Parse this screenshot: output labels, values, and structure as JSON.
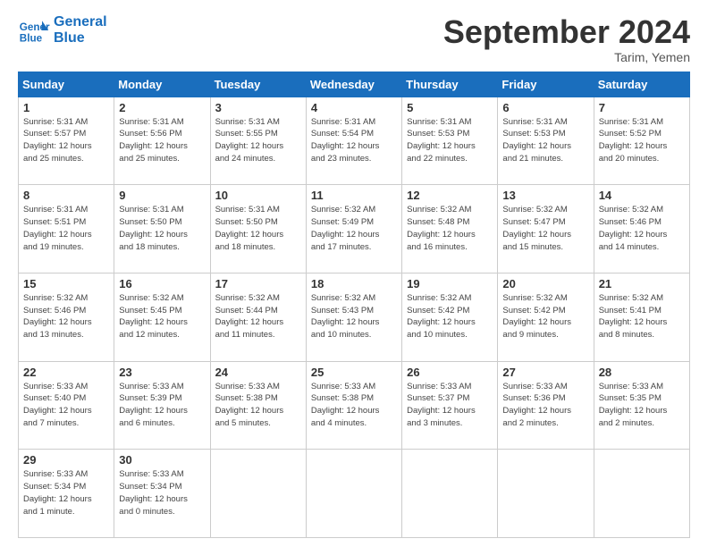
{
  "header": {
    "logo_line1": "General",
    "logo_line2": "Blue",
    "month_title": "September 2024",
    "location": "Tarim, Yemen"
  },
  "weekdays": [
    "Sunday",
    "Monday",
    "Tuesday",
    "Wednesday",
    "Thursday",
    "Friday",
    "Saturday"
  ],
  "weeks": [
    [
      {
        "day": 1,
        "info": "Sunrise: 5:31 AM\nSunset: 5:57 PM\nDaylight: 12 hours\nand 25 minutes."
      },
      {
        "day": 2,
        "info": "Sunrise: 5:31 AM\nSunset: 5:56 PM\nDaylight: 12 hours\nand 25 minutes."
      },
      {
        "day": 3,
        "info": "Sunrise: 5:31 AM\nSunset: 5:55 PM\nDaylight: 12 hours\nand 24 minutes."
      },
      {
        "day": 4,
        "info": "Sunrise: 5:31 AM\nSunset: 5:54 PM\nDaylight: 12 hours\nand 23 minutes."
      },
      {
        "day": 5,
        "info": "Sunrise: 5:31 AM\nSunset: 5:53 PM\nDaylight: 12 hours\nand 22 minutes."
      },
      {
        "day": 6,
        "info": "Sunrise: 5:31 AM\nSunset: 5:53 PM\nDaylight: 12 hours\nand 21 minutes."
      },
      {
        "day": 7,
        "info": "Sunrise: 5:31 AM\nSunset: 5:52 PM\nDaylight: 12 hours\nand 20 minutes."
      }
    ],
    [
      {
        "day": 8,
        "info": "Sunrise: 5:31 AM\nSunset: 5:51 PM\nDaylight: 12 hours\nand 19 minutes."
      },
      {
        "day": 9,
        "info": "Sunrise: 5:31 AM\nSunset: 5:50 PM\nDaylight: 12 hours\nand 18 minutes."
      },
      {
        "day": 10,
        "info": "Sunrise: 5:31 AM\nSunset: 5:50 PM\nDaylight: 12 hours\nand 18 minutes."
      },
      {
        "day": 11,
        "info": "Sunrise: 5:32 AM\nSunset: 5:49 PM\nDaylight: 12 hours\nand 17 minutes."
      },
      {
        "day": 12,
        "info": "Sunrise: 5:32 AM\nSunset: 5:48 PM\nDaylight: 12 hours\nand 16 minutes."
      },
      {
        "day": 13,
        "info": "Sunrise: 5:32 AM\nSunset: 5:47 PM\nDaylight: 12 hours\nand 15 minutes."
      },
      {
        "day": 14,
        "info": "Sunrise: 5:32 AM\nSunset: 5:46 PM\nDaylight: 12 hours\nand 14 minutes."
      }
    ],
    [
      {
        "day": 15,
        "info": "Sunrise: 5:32 AM\nSunset: 5:46 PM\nDaylight: 12 hours\nand 13 minutes."
      },
      {
        "day": 16,
        "info": "Sunrise: 5:32 AM\nSunset: 5:45 PM\nDaylight: 12 hours\nand 12 minutes."
      },
      {
        "day": 17,
        "info": "Sunrise: 5:32 AM\nSunset: 5:44 PM\nDaylight: 12 hours\nand 11 minutes."
      },
      {
        "day": 18,
        "info": "Sunrise: 5:32 AM\nSunset: 5:43 PM\nDaylight: 12 hours\nand 10 minutes."
      },
      {
        "day": 19,
        "info": "Sunrise: 5:32 AM\nSunset: 5:42 PM\nDaylight: 12 hours\nand 10 minutes."
      },
      {
        "day": 20,
        "info": "Sunrise: 5:32 AM\nSunset: 5:42 PM\nDaylight: 12 hours\nand 9 minutes."
      },
      {
        "day": 21,
        "info": "Sunrise: 5:32 AM\nSunset: 5:41 PM\nDaylight: 12 hours\nand 8 minutes."
      }
    ],
    [
      {
        "day": 22,
        "info": "Sunrise: 5:33 AM\nSunset: 5:40 PM\nDaylight: 12 hours\nand 7 minutes."
      },
      {
        "day": 23,
        "info": "Sunrise: 5:33 AM\nSunset: 5:39 PM\nDaylight: 12 hours\nand 6 minutes."
      },
      {
        "day": 24,
        "info": "Sunrise: 5:33 AM\nSunset: 5:38 PM\nDaylight: 12 hours\nand 5 minutes."
      },
      {
        "day": 25,
        "info": "Sunrise: 5:33 AM\nSunset: 5:38 PM\nDaylight: 12 hours\nand 4 minutes."
      },
      {
        "day": 26,
        "info": "Sunrise: 5:33 AM\nSunset: 5:37 PM\nDaylight: 12 hours\nand 3 minutes."
      },
      {
        "day": 27,
        "info": "Sunrise: 5:33 AM\nSunset: 5:36 PM\nDaylight: 12 hours\nand 2 minutes."
      },
      {
        "day": 28,
        "info": "Sunrise: 5:33 AM\nSunset: 5:35 PM\nDaylight: 12 hours\nand 2 minutes."
      }
    ],
    [
      {
        "day": 29,
        "info": "Sunrise: 5:33 AM\nSunset: 5:34 PM\nDaylight: 12 hours\nand 1 minute."
      },
      {
        "day": 30,
        "info": "Sunrise: 5:33 AM\nSunset: 5:34 PM\nDaylight: 12 hours\nand 0 minutes."
      },
      {
        "day": null,
        "info": ""
      },
      {
        "day": null,
        "info": ""
      },
      {
        "day": null,
        "info": ""
      },
      {
        "day": null,
        "info": ""
      },
      {
        "day": null,
        "info": ""
      }
    ]
  ]
}
